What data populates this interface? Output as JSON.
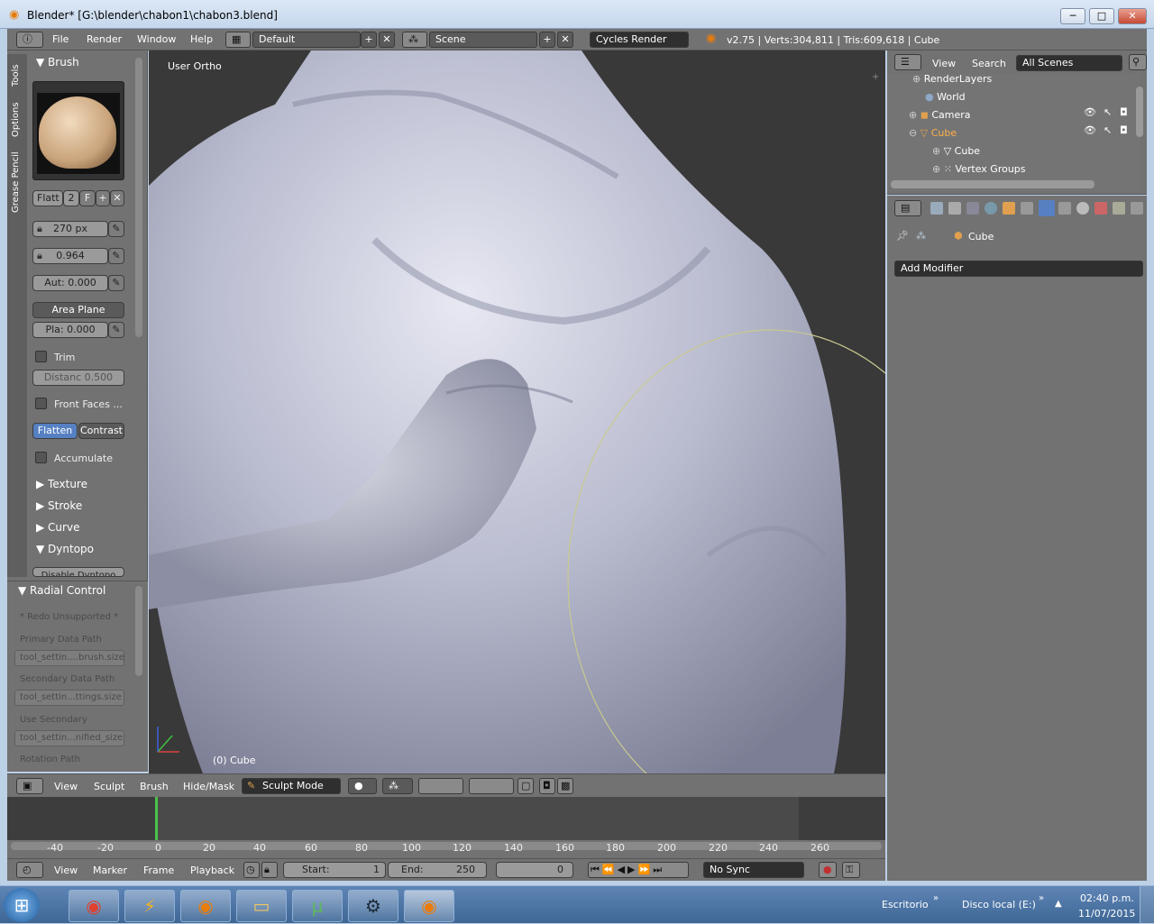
{
  "window": {
    "title": "Blender* [G:\\blender\\chabon1\\chabon3.blend]",
    "minimize": "─",
    "maximize": "□",
    "close": "✕"
  },
  "menu": {
    "items": [
      "File",
      "Render",
      "Window",
      "Help"
    ],
    "layout": "Default",
    "scene": "Scene",
    "engine": "Cycles Render",
    "stats": "v2.75 | Verts:304,811 | Tris:609,618 | Cube"
  },
  "tool_tabs": [
    "Tools",
    "Options",
    "Grease Pencil"
  ],
  "brush_panel": {
    "header": "Brush",
    "brush_name": "Flatt",
    "users": "2",
    "fake": "F",
    "radius": "270",
    "radius_unit": "px",
    "strength": "0.964",
    "autosmooth": "Aut: 0.000",
    "plane": "Area Plane",
    "plane_offset": "Pla: 0.000",
    "trim": "Trim",
    "trim_distance": "Distanc 0.500",
    "front_faces": "Front Faces ...",
    "flatten": "Flatten",
    "contrast": "Contrast",
    "accumulate": "Accumulate",
    "sections": [
      "Texture",
      "Stroke",
      "Curve",
      "Dyntopo"
    ],
    "dyntopo_btn": "Disable Dyntopo"
  },
  "radial_panel": {
    "header": "Radial Control",
    "redo": "* Redo Unsupported *",
    "primary_label": "Primary Data Path",
    "primary_value": "tool_settin....brush.size",
    "secondary_label": "Secondary Data Path",
    "secondary_value": "tool_settin...ttings.size",
    "use_secondary_label": "Use Secondary",
    "use_secondary_value": "tool_settin...nified_size",
    "rotation_label": "Rotation Path"
  },
  "viewport": {
    "label": "User Ortho",
    "object": "(0) Cube"
  },
  "outliner": {
    "menu": [
      "View",
      "Search"
    ],
    "scenes": "All Scenes",
    "rows": [
      {
        "label": "RenderLayers",
        "indent": 1
      },
      {
        "label": "World",
        "indent": 1
      },
      {
        "label": "Camera",
        "indent": 1
      },
      {
        "label": "Cube",
        "indent": 1
      },
      {
        "label": "Cube",
        "indent": 2
      },
      {
        "label": "Vertex Groups",
        "indent": 2
      }
    ]
  },
  "properties": {
    "object": "Cube",
    "add_modifier": "Add Modifier"
  },
  "viewport_header": {
    "menus": [
      "View",
      "Sculpt",
      "Brush",
      "Hide/Mask"
    ],
    "mode": "Sculpt Mode"
  },
  "timeline": {
    "ticks": [
      "-40",
      "-20",
      "0",
      "20",
      "40",
      "60",
      "80",
      "100",
      "120",
      "140",
      "160",
      "180",
      "200",
      "220",
      "240",
      "260"
    ],
    "menus": [
      "View",
      "Marker",
      "Frame",
      "Playback"
    ],
    "start_label": "Start:",
    "start": "1",
    "end_label": "End:",
    "end": "250",
    "current": "0",
    "sync": "No Sync"
  },
  "taskbar": {
    "start": "⊞",
    "apps": [
      "Chrome",
      "Winamp",
      "Blender",
      "Explorer",
      "uTorrent",
      "Steam",
      "Blender"
    ],
    "toolbar1": "Escritorio",
    "toolbar2": "Disco local (E:)",
    "time": "02:40 p.m.",
    "date": "11/07/2015"
  }
}
